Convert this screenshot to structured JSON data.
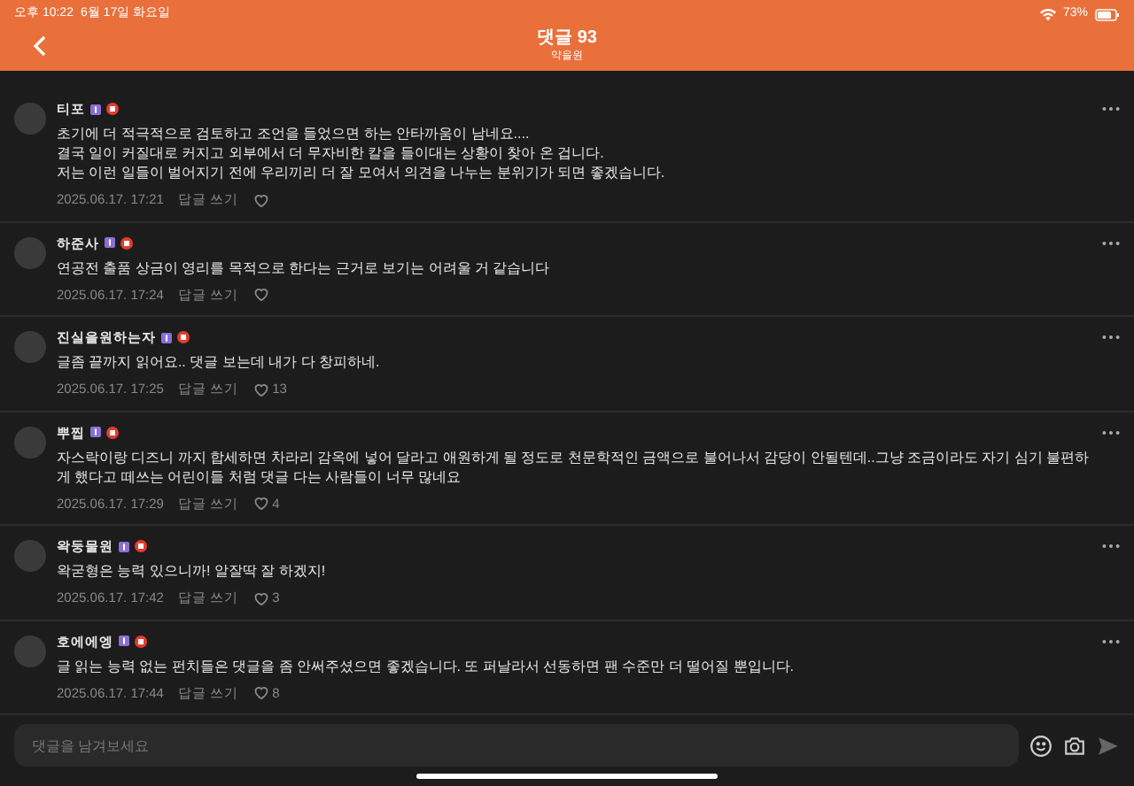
{
  "status_bar": {
    "time": "오후 10:22",
    "date": "6월 17일 화요일",
    "battery": "73%"
  },
  "header": {
    "title": "댓글 93",
    "subtitle": "약을원"
  },
  "comments": [
    {
      "author": "티포",
      "text": "초기에 더 적극적으로 검토하고 조언을 들었으면 하는 안타까움이 남네요....\n결국 일이 커질대로 커지고 외부에서 더 무자비한 칼을 들이대는 상황이 찾아 온 겁니다.\n저는 이런 일들이 벌어지기 전에 우리끼리 더 잘 모여서 의견을 나누는 분위기가 되면 좋겠습니다.",
      "date": "2025.06.17. 17:21",
      "reply": "답글 쓰기"
    },
    {
      "author": "하준사",
      "text": "연공전 출품 상금이 영리를 목적으로 한다는 근거로 보기는 어려울 거 같습니다",
      "date": "2025.06.17. 17:24",
      "reply": "답글 쓰기"
    },
    {
      "author": "진실을원하는자",
      "text": "글좀 끝까지 읽어요.. 댓글 보는데 내가 다 창피하네.",
      "date": "2025.06.17. 17:25",
      "reply": "답글 쓰기",
      "likes": "13"
    },
    {
      "author": "뿌찝",
      "text": "자스락이랑 디즈니 까지 합세하면 차라리 감옥에 넣어 달라고 애원하게 될 정도로 천문학적인 금액으로 불어나서 감당이 안될텐데..그냥 조금이라도 자기 심기 불편하게 했다고 떼쓰는 어린이들 처럼 댓글 다는 사람들이 너무 많네요",
      "date": "2025.06.17. 17:29",
      "reply": "답글 쓰기",
      "likes": "4"
    },
    {
      "author": "왁둥물원",
      "text": "왁굳형은 능력 있으니까! 알잘딱 잘 하겠지!",
      "date": "2025.06.17. 17:42",
      "reply": "답글 쓰기",
      "likes": "3"
    },
    {
      "author": "호에에엥",
      "text": "글 읽는 능력 없는 펀치들은 댓글을 좀 안써주셨으면 좋겠습니다. 또 퍼날라서 선동하면 팬 수준만 더 떨어질 뿐입니다.",
      "date": "2025.06.17. 17:44",
      "reply": "답글 쓰기",
      "likes": "8"
    }
  ],
  "composer": {
    "placeholder": "댓글을 남겨보세요"
  }
}
